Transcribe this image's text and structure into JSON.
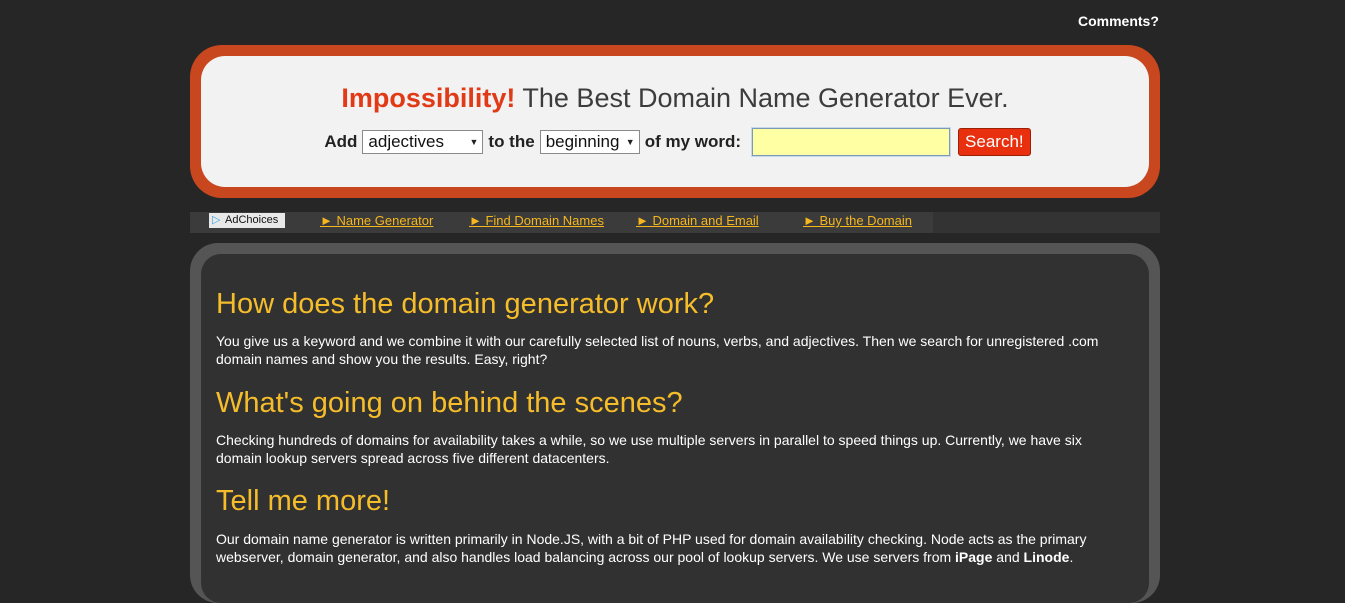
{
  "header": {
    "comments_link": "Comments?"
  },
  "search": {
    "brand": "Impossibility!",
    "tagline": "The Best Domain Name Generator Ever.",
    "add_label": "Add",
    "word_type_selected": "adjectives",
    "to_the_label": "to the",
    "position_selected": "beginning",
    "of_word_label": "of my word:",
    "input_value": "",
    "button_label": "Search!"
  },
  "nav": {
    "adchoices": "AdChoices",
    "links": [
      "► Name Generator",
      "► Find Domain Names",
      "► Domain and Email",
      "► Buy the Domain"
    ]
  },
  "content": {
    "sections": [
      {
        "heading": "How does the domain generator work?",
        "body": "You give us a keyword and we combine it with our carefully selected list of nouns, verbs, and adjectives. Then we search for unregistered .com domain names and show you the results. Easy, right?"
      },
      {
        "heading": "What's going on behind the scenes?",
        "body": "Checking hundreds of domains for availability takes a while, so we use multiple servers in parallel to speed things up. Currently, we have six domain lookup servers spread across five different datacenters."
      },
      {
        "heading": "Tell me more!",
        "body_pre": "Our domain name generator is written primarily in Node.JS, with a bit of PHP used for domain availability checking. Node acts as the primary webserver, domain generator, and also handles load balancing across our pool of lookup servers. We use servers from ",
        "host1": "iPage",
        "body_mid": " and ",
        "host2": "Linode",
        "body_post": "."
      }
    ]
  },
  "colors": {
    "background": "#262626",
    "frame_orange": "#c9471e",
    "brand_red": "#e03a17",
    "heading_yellow": "#f6bd2a",
    "input_yellow": "#ffffa4",
    "button_red": "#e8300f"
  }
}
